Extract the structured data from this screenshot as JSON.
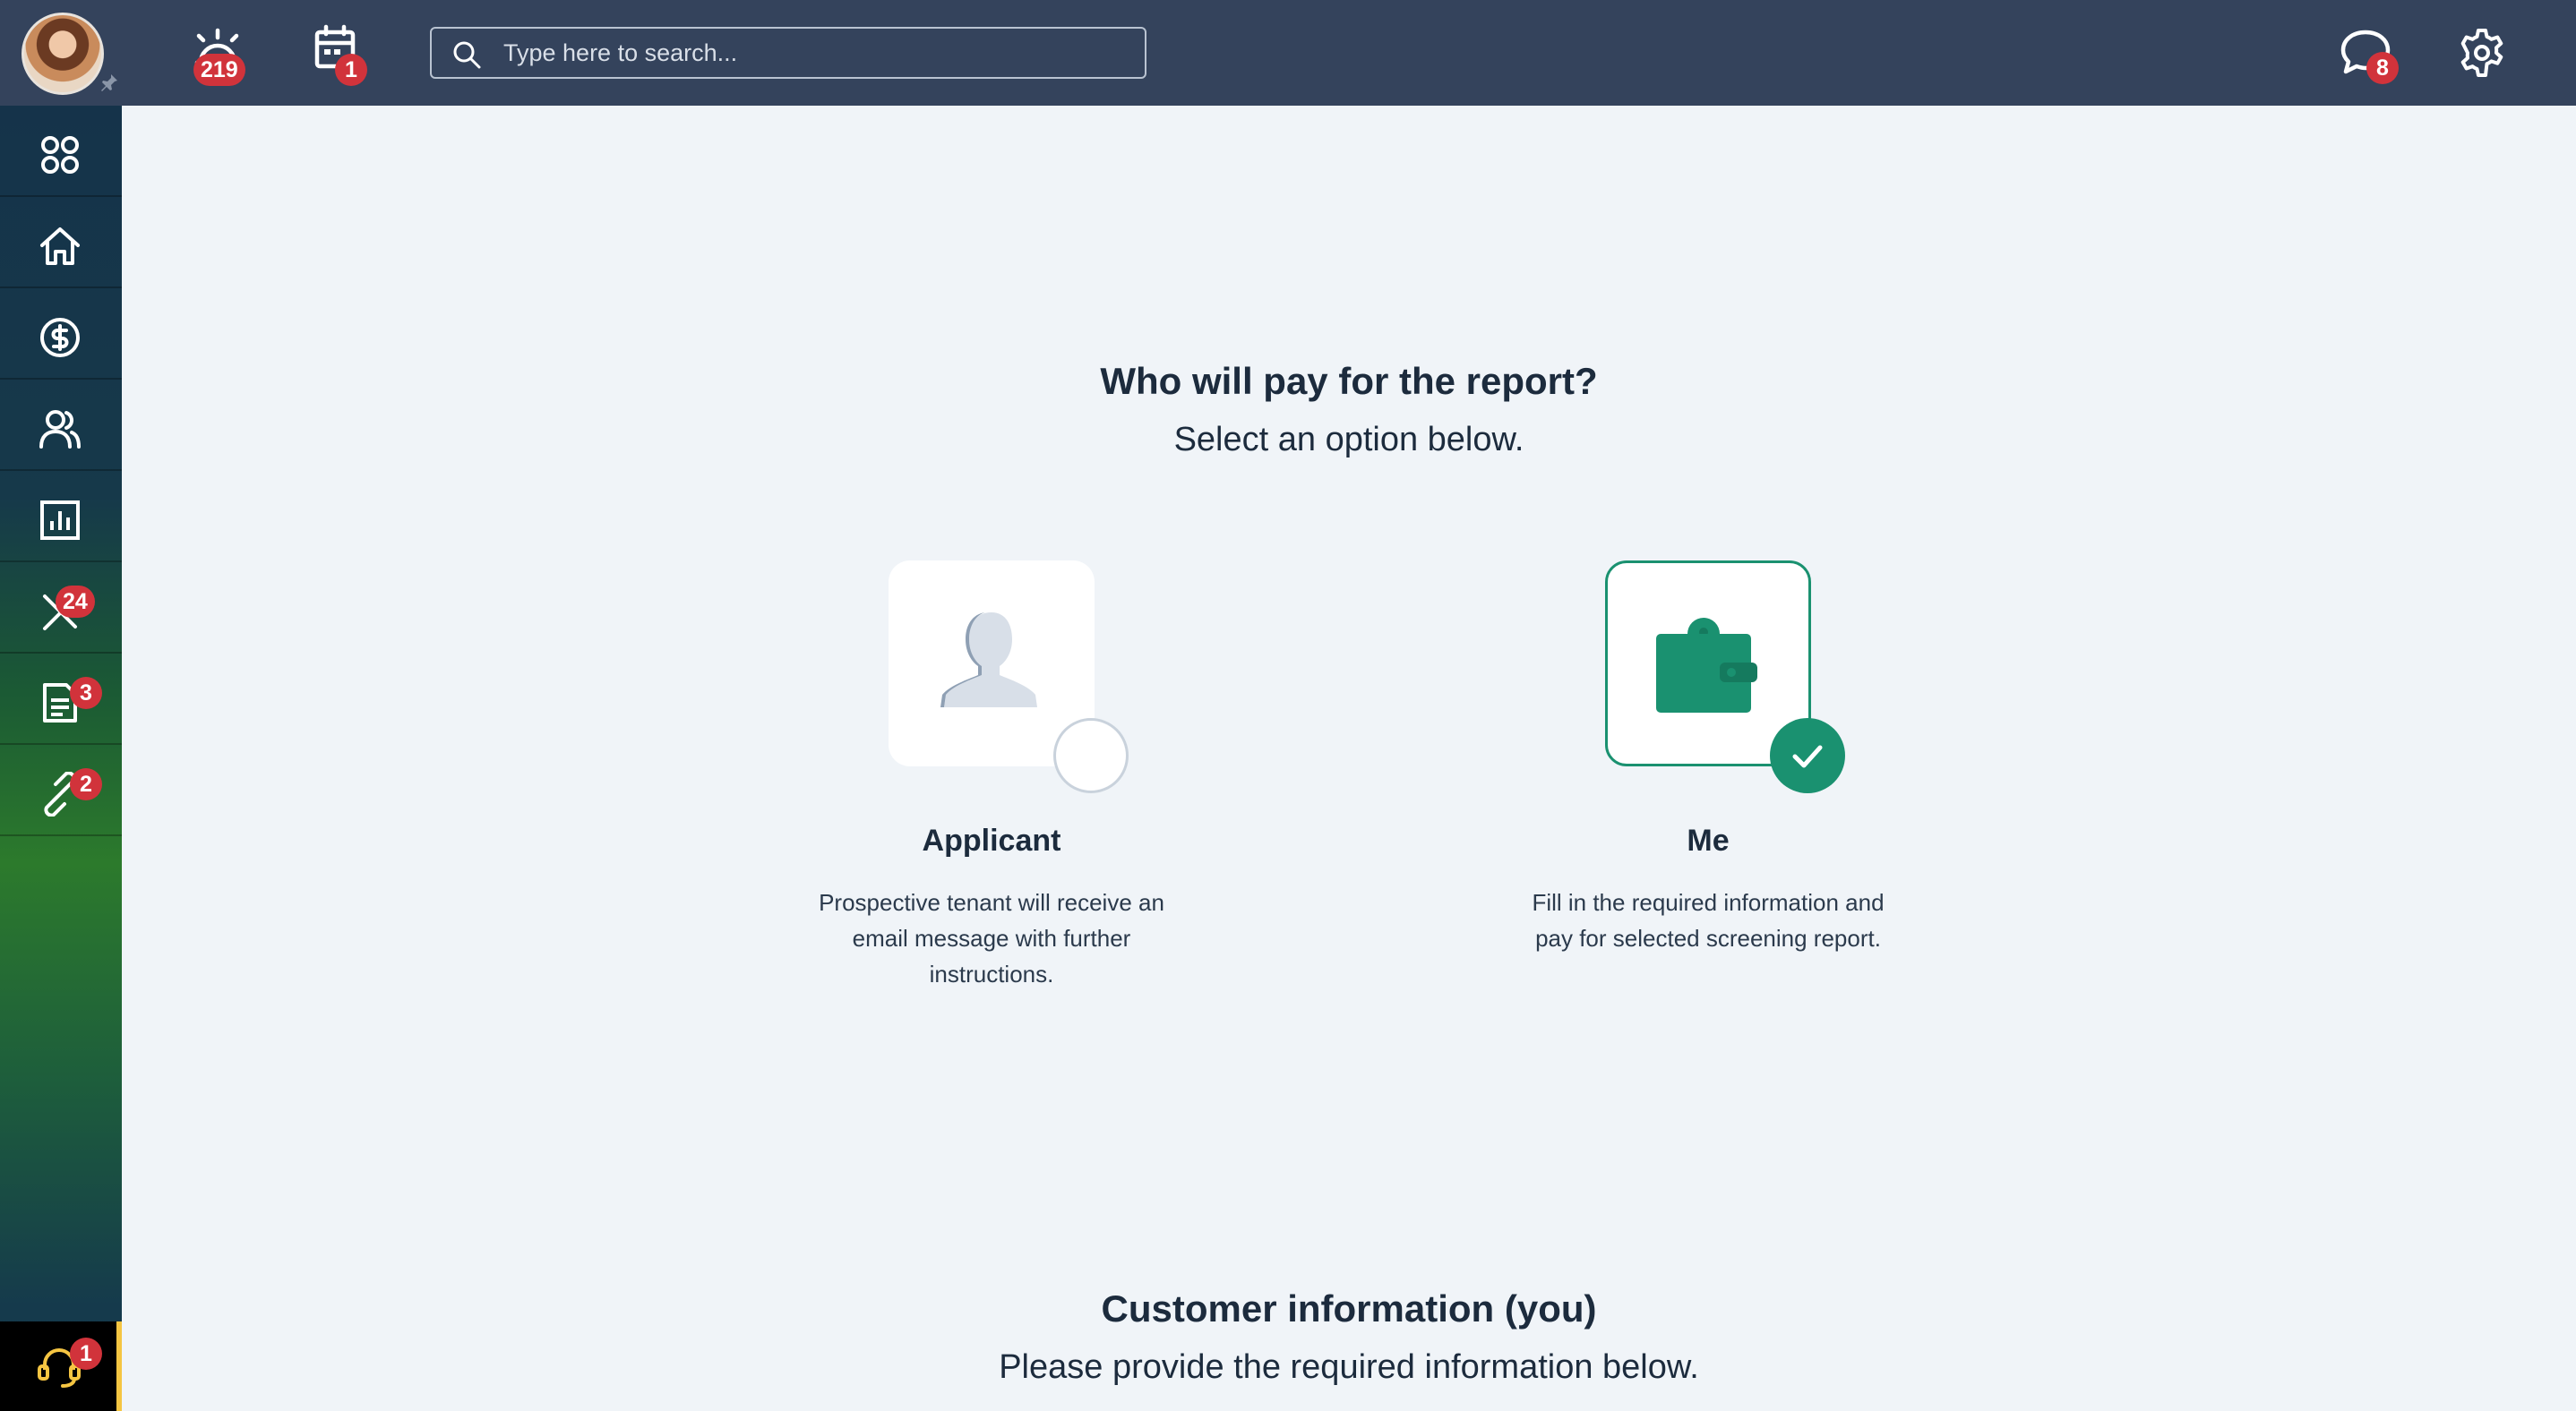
{
  "topbar": {
    "notifications_count": "219",
    "calendar_count": "1",
    "search_placeholder": "Type here to search...",
    "messages_count": "8"
  },
  "sidebar": {
    "items": [
      {
        "name": "apps",
        "icon": "apps-grid-icon",
        "badge": ""
      },
      {
        "name": "home",
        "icon": "home-icon",
        "badge": ""
      },
      {
        "name": "accounting",
        "icon": "dollar-icon",
        "badge": ""
      },
      {
        "name": "people",
        "icon": "people-icon",
        "badge": ""
      },
      {
        "name": "reports",
        "icon": "bar-chart-icon",
        "badge": ""
      },
      {
        "name": "maintenance",
        "icon": "tools-icon",
        "badge": "24"
      },
      {
        "name": "documents",
        "icon": "document-icon",
        "badge": "3"
      },
      {
        "name": "connections",
        "icon": "link-icon",
        "badge": "2"
      }
    ],
    "support_badge": "1"
  },
  "payer": {
    "title": "Who will pay for the report?",
    "subtitle": "Select an option below.",
    "options": [
      {
        "title": "Applicant",
        "description": "Prospective tenant will receive an email message with further instructions.",
        "selected": false
      },
      {
        "title": "Me",
        "description": "Fill in the required information and pay for selected screening report.",
        "selected": true
      }
    ]
  },
  "customer": {
    "title": "Customer information (you)",
    "subtitle": "Please provide the required information below."
  },
  "colors": {
    "topbar": "#34435c",
    "accent_green": "#1a9170",
    "badge_red": "#d1333b",
    "background": "#f0f4f8"
  }
}
